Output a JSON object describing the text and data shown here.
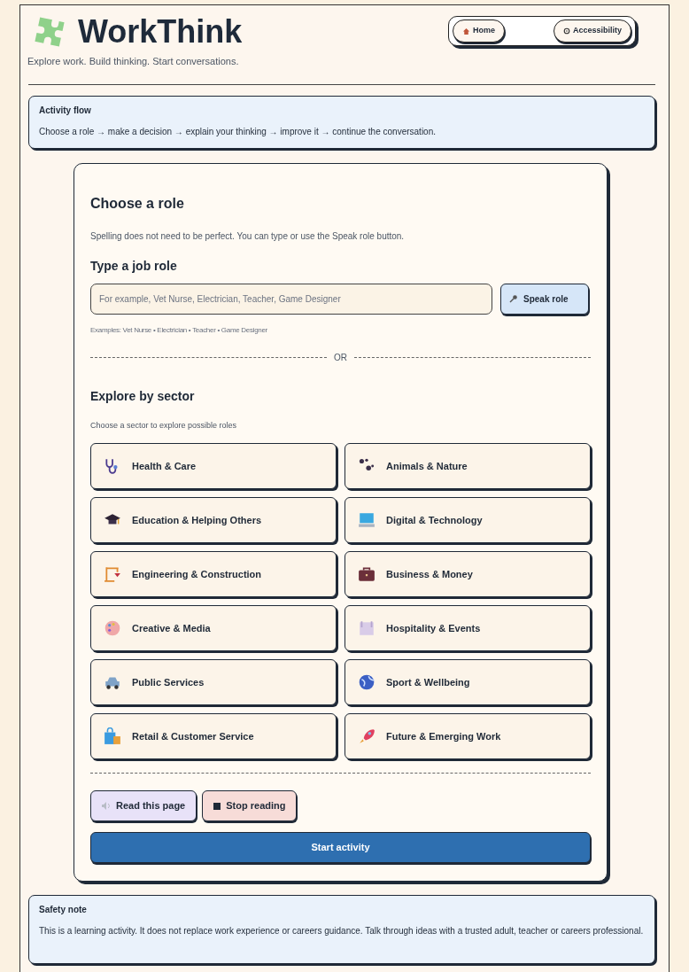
{
  "header": {
    "title": "WorkThink",
    "tagline": "Explore work. Build thinking. Start conversations.",
    "nav": [
      {
        "label": "Home",
        "kind": "home"
      },
      {
        "label": "Accessibility",
        "kind": "accessibility"
      }
    ]
  },
  "activity_flow": {
    "title": "Activity flow",
    "text": "Choose a role → make a decision → explain your thinking → improve it → continue the conversation."
  },
  "card": {
    "title": "Choose a role",
    "intro": "Spelling does not need to be perfect. You can type or use the Speak role button.",
    "job_role": {
      "heading": "Type a job role",
      "placeholder": "For example, Vet Nurse, Electrician, Teacher, Game Designer",
      "speak_button": "Speak role",
      "examples": "Examples: Vet Nurse • Electrician • Teacher • Game Designer"
    },
    "divider": "OR",
    "sectors": {
      "heading": "Explore by sector",
      "hint": "Choose a sector to explore possible roles",
      "items": [
        {
          "label": "Health & Care"
        },
        {
          "label": "Animals & Nature"
        },
        {
          "label": "Education & Helping Others"
        },
        {
          "label": "Digital & Technology"
        },
        {
          "label": "Engineering & Construction"
        },
        {
          "label": "Business & Money"
        },
        {
          "label": "Creative & Media"
        },
        {
          "label": "Hospitality & Events"
        },
        {
          "label": "Public Services"
        },
        {
          "label": "Sport & Wellbeing"
        },
        {
          "label": "Retail & Customer Service"
        },
        {
          "label": "Future & Emerging Work"
        }
      ]
    },
    "read_buttons": [
      {
        "label": "Read this page",
        "kind": "read"
      },
      {
        "label": "Stop reading",
        "kind": "stop"
      }
    ],
    "start_button": "Start activity"
  },
  "safety_note": {
    "title": "Safety note",
    "text": "This is a learning activity. It does not replace work experience or careers guidance. Talk through ideas with a trusted adult, teacher or careers professional."
  }
}
